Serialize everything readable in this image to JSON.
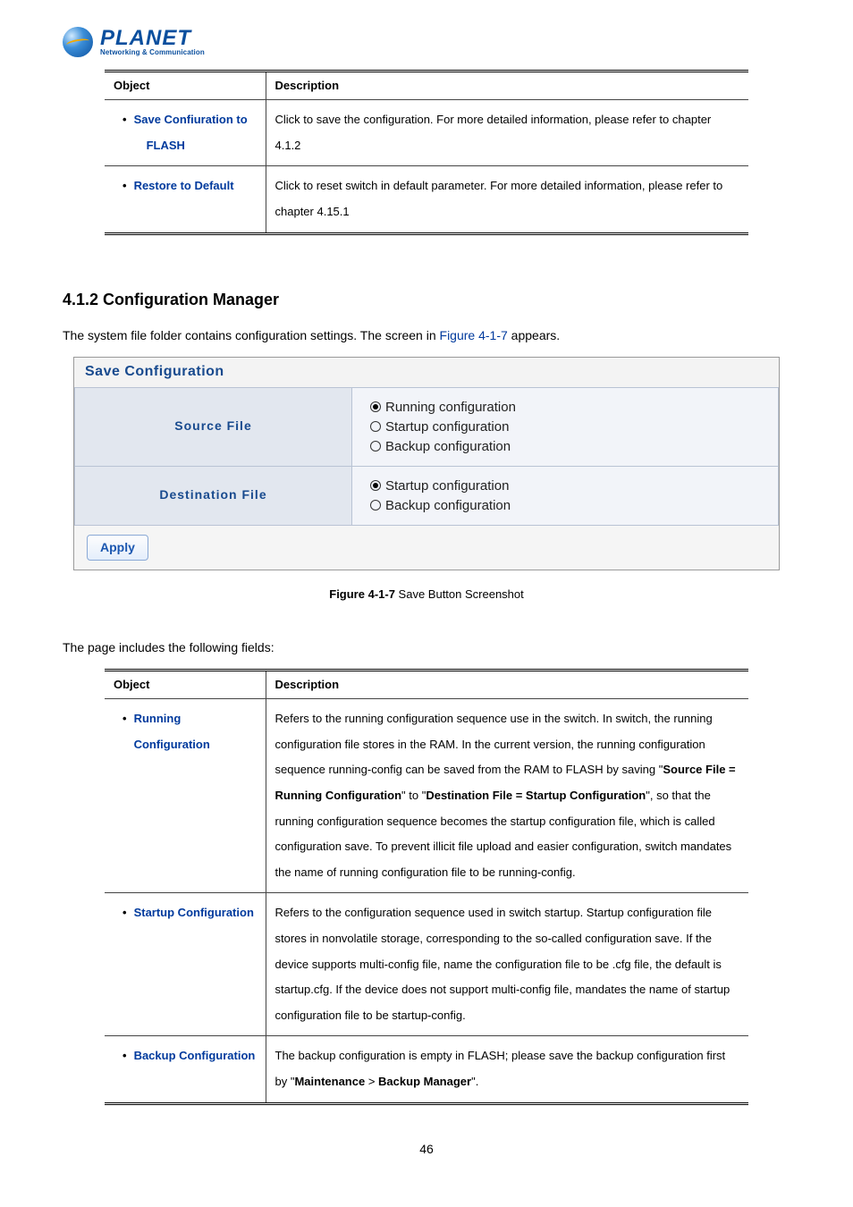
{
  "logo": {
    "brand": "PLANET",
    "tagline": "Networking & Communication"
  },
  "table1": {
    "headers": {
      "object": "Object",
      "description": "Description"
    },
    "rows": [
      {
        "object_line1": "Save Confiuration to",
        "object_line2": "FLASH",
        "desc": "Click to save the configuration. For more detailed information, please refer to chapter 4.1.2"
      },
      {
        "object_line1": "Restore to Default",
        "object_line2": "",
        "desc": "Click to reset switch in default parameter. For more detailed information, please refer to chapter 4.15.1"
      }
    ]
  },
  "section_heading": "4.1.2 Configuration Manager",
  "lead_pre": "The system file folder contains configuration settings. The screen in ",
  "lead_link": "Figure 4-1-7",
  "lead_post": " appears.",
  "screenshot": {
    "title": "Save Configuration",
    "row1_label": "Source File",
    "row2_label": "Destination File",
    "opt_running": "Running configuration",
    "opt_startup": "Startup configuration",
    "opt_backup": "Backup configuration",
    "apply": "Apply"
  },
  "figure_caption_bold": "Figure 4-1-7",
  "figure_caption_rest": " Save Button Screenshot",
  "fields_intro": "The page includes the following fields:",
  "table2": {
    "headers": {
      "object": "Object",
      "description": "Description"
    },
    "rows": [
      {
        "object": "Running Configuration",
        "d1": "Refers to the running configuration sequence use in the switch. In switch, the running configuration file stores in the RAM. In the current version, the running configuration sequence running-config can be saved from the RAM to FLASH by saving \"",
        "b1": "Source File = Running Configuration",
        "d2": "\" to \"",
        "b2": "Destination File = Startup Configuration",
        "d3": "\", so that the running configuration sequence becomes the startup configuration file, which is called configuration save. To prevent illicit file upload and easier configuration, switch mandates the name of running configuration file to be running-config."
      },
      {
        "object": "Startup Configuration",
        "d1": "Refers to the configuration sequence used in switch startup. Startup configuration file stores in nonvolatile storage, corresponding to the so-called configuration save. If the device supports multi-config file, name the configuration file to be .cfg file, the default is startup.cfg. If the device does not support multi-config file, mandates the name of startup configuration file to be startup-config."
      },
      {
        "object": "Backup Configuration",
        "d1": "The backup configuration is empty in FLASH; please save the backup configuration first by \"",
        "b1": "Maintenance",
        "d2": " > ",
        "b2": "Backup Manager",
        "d3": "\"."
      }
    ]
  },
  "page_number": "46"
}
